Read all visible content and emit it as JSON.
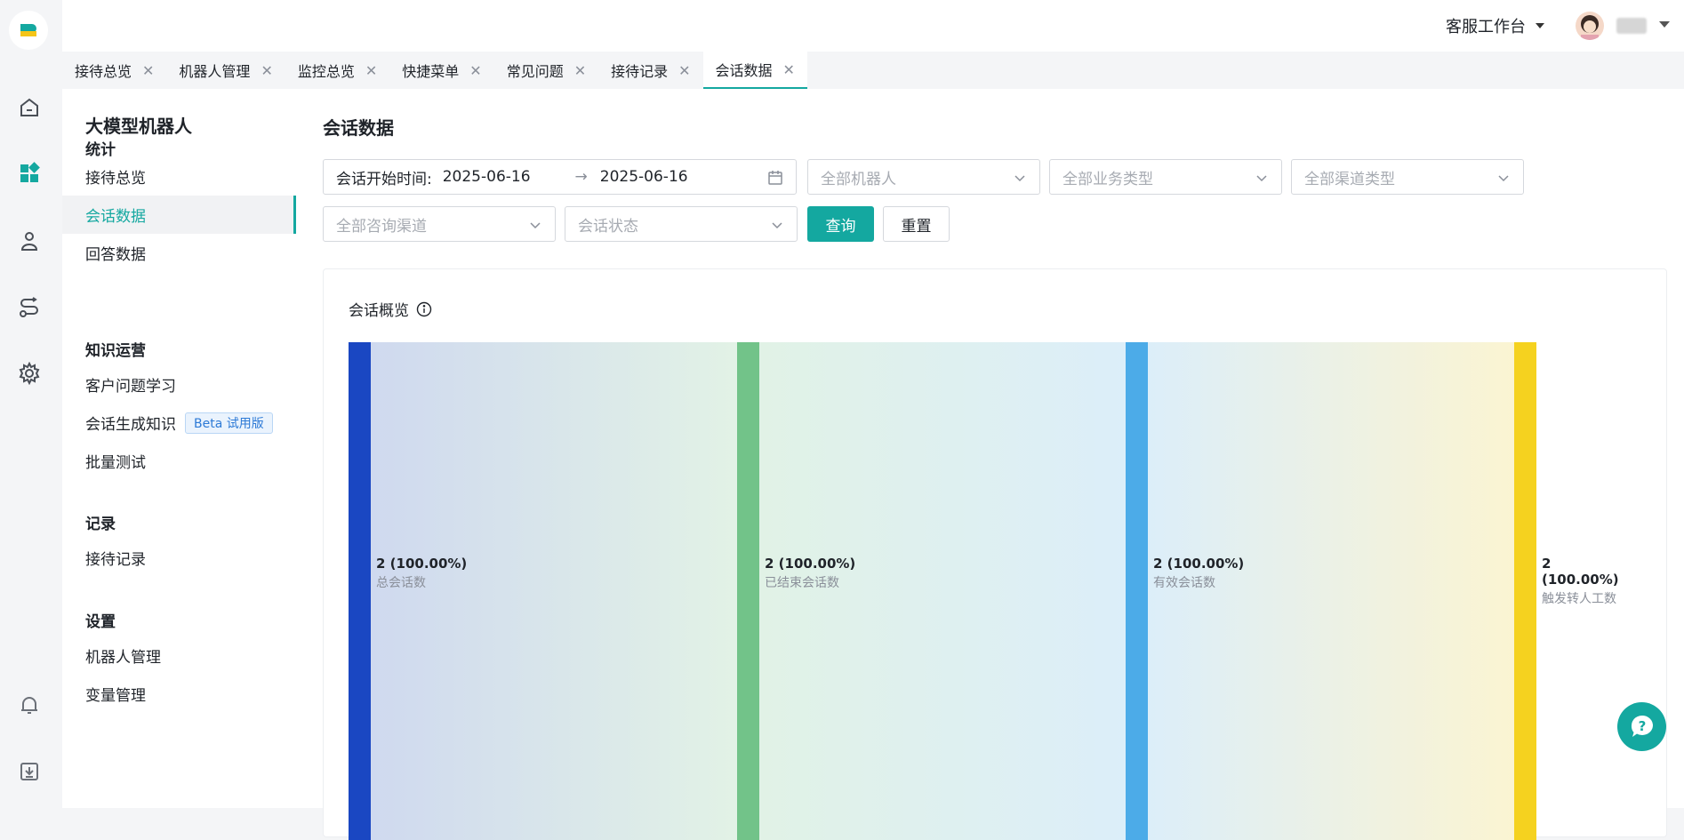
{
  "header": {
    "workbench_label": "客服工作台"
  },
  "tabs": [
    {
      "label": "接待总览"
    },
    {
      "label": "机器人管理"
    },
    {
      "label": "监控总览"
    },
    {
      "label": "快捷菜单"
    },
    {
      "label": "常见问题"
    },
    {
      "label": "接待记录"
    },
    {
      "label": "会话数据",
      "active": true
    }
  ],
  "sidebar": {
    "title": "大模型机器人",
    "groups": [
      {
        "label": "统计",
        "items": [
          {
            "label": "接待总览"
          },
          {
            "label": "会话数据",
            "active": true
          },
          {
            "label": "回答数据"
          }
        ]
      },
      {
        "label": "知识运营",
        "items": [
          {
            "label": "客户问题学习"
          },
          {
            "label": "会话生成知识",
            "badge": "Beta 试用版"
          },
          {
            "label": "批量测试"
          }
        ]
      },
      {
        "label": "记录",
        "items": [
          {
            "label": "接待记录"
          }
        ]
      },
      {
        "label": "设置",
        "items": [
          {
            "label": "机器人管理"
          },
          {
            "label": "变量管理"
          }
        ]
      }
    ]
  },
  "main": {
    "title": "会话数据",
    "filters": {
      "date_label": "会话开始时间:",
      "date_start": "2025-06-16",
      "date_end": "2025-06-16",
      "robot_placeholder": "全部机器人",
      "business_placeholder": "全部业务类型",
      "channel_type_placeholder": "全部渠道类型",
      "consult_channel_placeholder": "全部咨询渠道",
      "status_placeholder": "会话状态",
      "query_label": "查询",
      "reset_label": "重置"
    },
    "overview": {
      "title": "会话概览"
    }
  },
  "chart_data": {
    "type": "funnel",
    "stages": [
      {
        "name": "总会话数",
        "value": 2,
        "percent": "100.00%",
        "color": "#1a47c2"
      },
      {
        "name": "已结束会话数",
        "value": 2,
        "percent": "100.00%",
        "color": "#72c389"
      },
      {
        "name": "有效会话数",
        "value": 2,
        "percent": "100.00%",
        "color": "#4cabe8"
      },
      {
        "name": "触发转人工数",
        "value": 2,
        "percent": "100.00%",
        "color": "#f5d21f"
      }
    ],
    "labels": [
      {
        "value_text": "2 (100.00%)",
        "name": "总会话数"
      },
      {
        "value_text": "2 (100.00%)",
        "name": "已结束会话数"
      },
      {
        "value_text": "2 (100.00%)",
        "name": "有效会话数"
      },
      {
        "value_text": "2 (100.00%)",
        "name": "触发转人工数"
      }
    ]
  }
}
